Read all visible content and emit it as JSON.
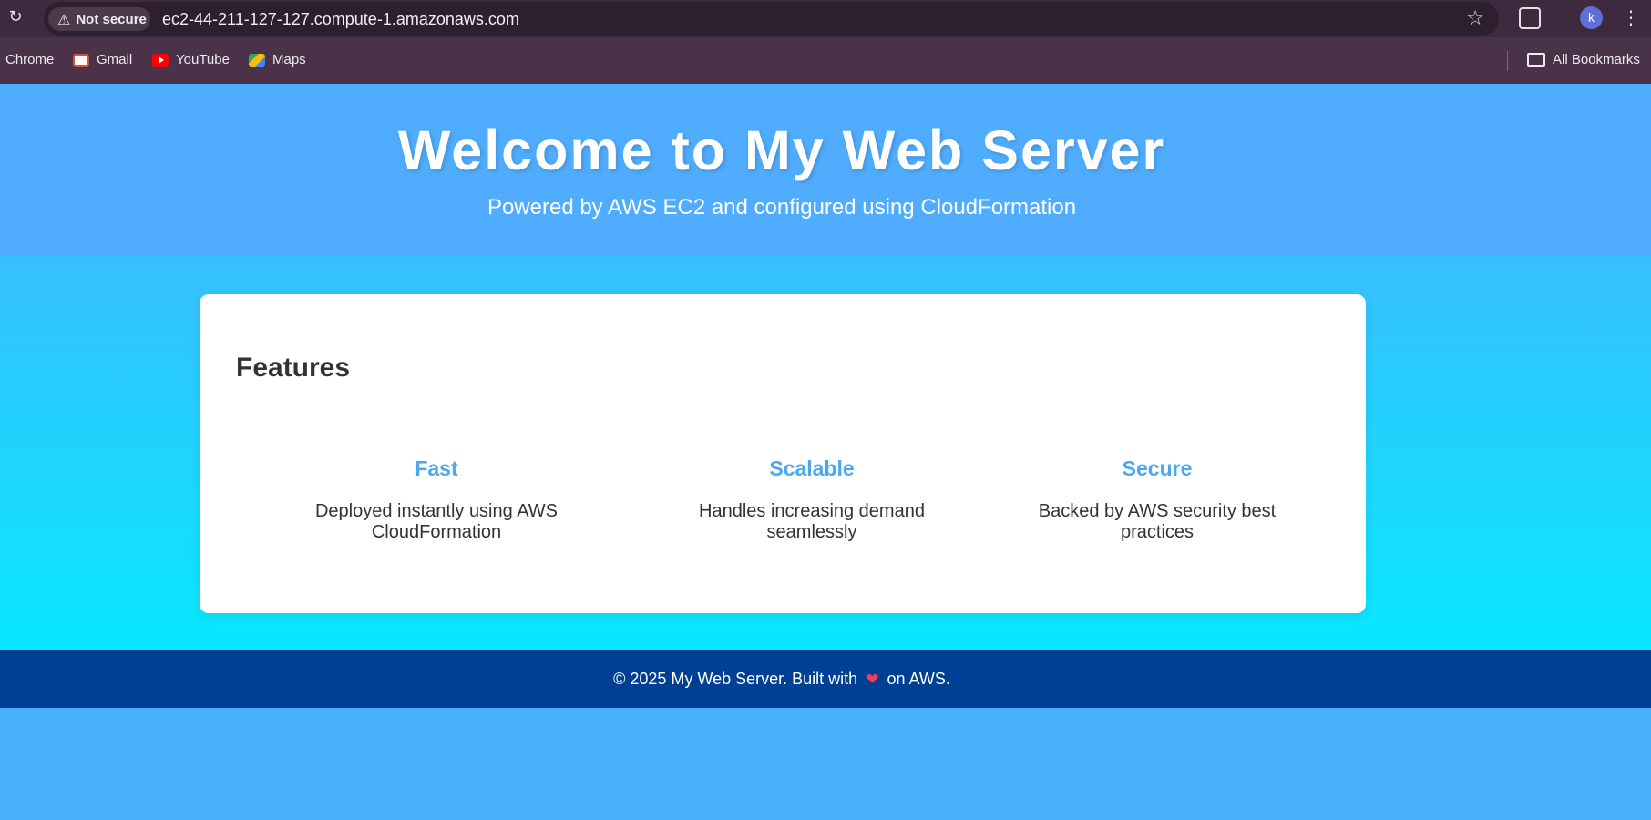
{
  "browser": {
    "security_label": "Not secure",
    "url": "ec2-44-211-127-127.compute-1.amazonaws.com",
    "profile_initial": "k",
    "bookmarks": [
      {
        "label": "Chrome"
      },
      {
        "label": "Gmail"
      },
      {
        "label": "YouTube"
      },
      {
        "label": "Maps"
      }
    ],
    "all_bookmarks_label": "All Bookmarks"
  },
  "hero": {
    "title": "Welcome to My Web Server",
    "subtitle": "Powered by AWS EC2 and configured using CloudFormation"
  },
  "features": {
    "heading": "Features",
    "items": [
      {
        "title": "Fast",
        "description": "Deployed instantly using AWS CloudFormation"
      },
      {
        "title": "Scalable",
        "description": "Handles increasing demand seamlessly"
      },
      {
        "title": "Secure",
        "description": "Backed by AWS security best practices"
      }
    ]
  },
  "footer": {
    "before": "© 2025 My Web Server. Built with",
    "heart": "❤",
    "after": "on AWS."
  },
  "colors": {
    "hero_bg": "#4facfe",
    "gradient_top": "#37bffd",
    "gradient_bottom": "#08e8fd",
    "feature_title": "#4ba8f0",
    "footer_bg": "#004094"
  }
}
